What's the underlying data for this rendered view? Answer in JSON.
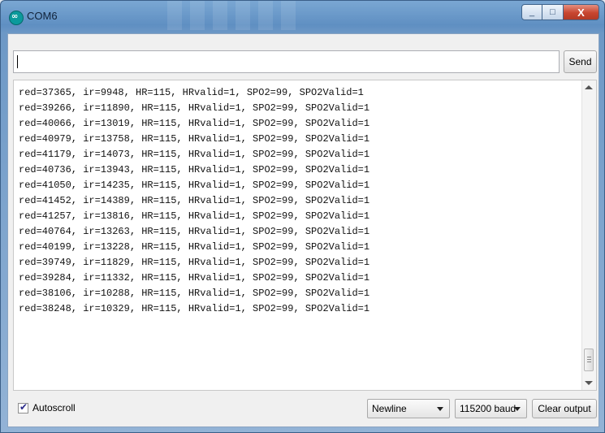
{
  "window": {
    "title": "COM6",
    "icon": "arduino-infinity-icon",
    "close_glyph": "X",
    "minimize_glyph": "_",
    "maximize_glyph": "□"
  },
  "send": {
    "input_value": "",
    "button_label": "Send"
  },
  "output": {
    "lines": [
      "red=37365, ir=9948, HR=115, HRvalid=1, SPO2=99, SPO2Valid=1",
      "red=39266, ir=11890, HR=115, HRvalid=1, SPO2=99, SPO2Valid=1",
      "red=40066, ir=13019, HR=115, HRvalid=1, SPO2=99, SPO2Valid=1",
      "red=40979, ir=13758, HR=115, HRvalid=1, SPO2=99, SPO2Valid=1",
      "red=41179, ir=14073, HR=115, HRvalid=1, SPO2=99, SPO2Valid=1",
      "red=40736, ir=13943, HR=115, HRvalid=1, SPO2=99, SPO2Valid=1",
      "red=41050, ir=14235, HR=115, HRvalid=1, SPO2=99, SPO2Valid=1",
      "red=41452, ir=14389, HR=115, HRvalid=1, SPO2=99, SPO2Valid=1",
      "red=41257, ir=13816, HR=115, HRvalid=1, SPO2=99, SPO2Valid=1",
      "red=40764, ir=13263, HR=115, HRvalid=1, SPO2=99, SPO2Valid=1",
      "red=40199, ir=13228, HR=115, HRvalid=1, SPO2=99, SPO2Valid=1",
      "red=39749, ir=11829, HR=115, HRvalid=1, SPO2=99, SPO2Valid=1",
      "red=39284, ir=11332, HR=115, HRvalid=1, SPO2=99, SPO2Valid=1",
      "red=38106, ir=10288, HR=115, HRvalid=1, SPO2=99, SPO2Valid=1",
      "red=38248, ir=10329, HR=115, HRvalid=1, SPO2=99, SPO2Valid=1"
    ]
  },
  "footer": {
    "autoscroll_label": "Autoscroll",
    "autoscroll_checked": true,
    "line_ending_selected": "Newline",
    "baud_selected": "115200 baud",
    "clear_label": "Clear output"
  },
  "colors": {
    "titlebar": "#5f8fc2",
    "close_button": "#c8452f",
    "app_icon": "#0b9a9c"
  }
}
